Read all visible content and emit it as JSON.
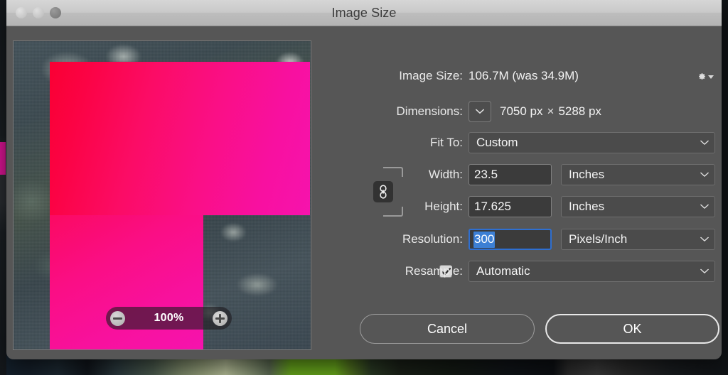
{
  "window": {
    "title": "Image Size",
    "traffic_lights": [
      "close-button",
      "minimize-button",
      "zoom-button"
    ]
  },
  "preview": {
    "zoom_level": "100%",
    "zoom_out_label": "minus-icon",
    "zoom_in_label": "plus-icon"
  },
  "form": {
    "image_size": {
      "label": "Image Size:",
      "value": "106.7M (was 34.9M)",
      "gear_icon": "gear-icon"
    },
    "dimensions": {
      "label": "Dimensions:",
      "disclosure_icon": "chevron-down-icon",
      "width_px": "7050 px",
      "separator": "×",
      "height_px": "5288 px"
    },
    "fit_to": {
      "label": "Fit To:",
      "value": "Custom"
    },
    "width": {
      "label": "Width:",
      "value": "23.5",
      "unit": "Inches"
    },
    "height": {
      "label": "Height:",
      "value": "17.625",
      "unit": "Inches"
    },
    "resolution": {
      "label": "Resolution:",
      "value": "300",
      "unit": "Pixels/Inch",
      "focused": true,
      "selected": true
    },
    "resample": {
      "label": "Resample:",
      "checked": true,
      "value": "Automatic"
    },
    "constrain_icon": "chain-link-icon"
  },
  "buttons": {
    "cancel": "Cancel",
    "ok": "OK"
  },
  "colors": {
    "dialog_bg": "#565656",
    "titlebar": "#c9c9c9",
    "input_bg": "#3b3b3b",
    "select_bg": "#4b4b4b",
    "focus_border": "#2f6fd0",
    "selection_blue": "#3c7fd4",
    "text": "#f2f2f2",
    "magenta": "#fa0f86",
    "accent_green": "#6aab1c"
  }
}
